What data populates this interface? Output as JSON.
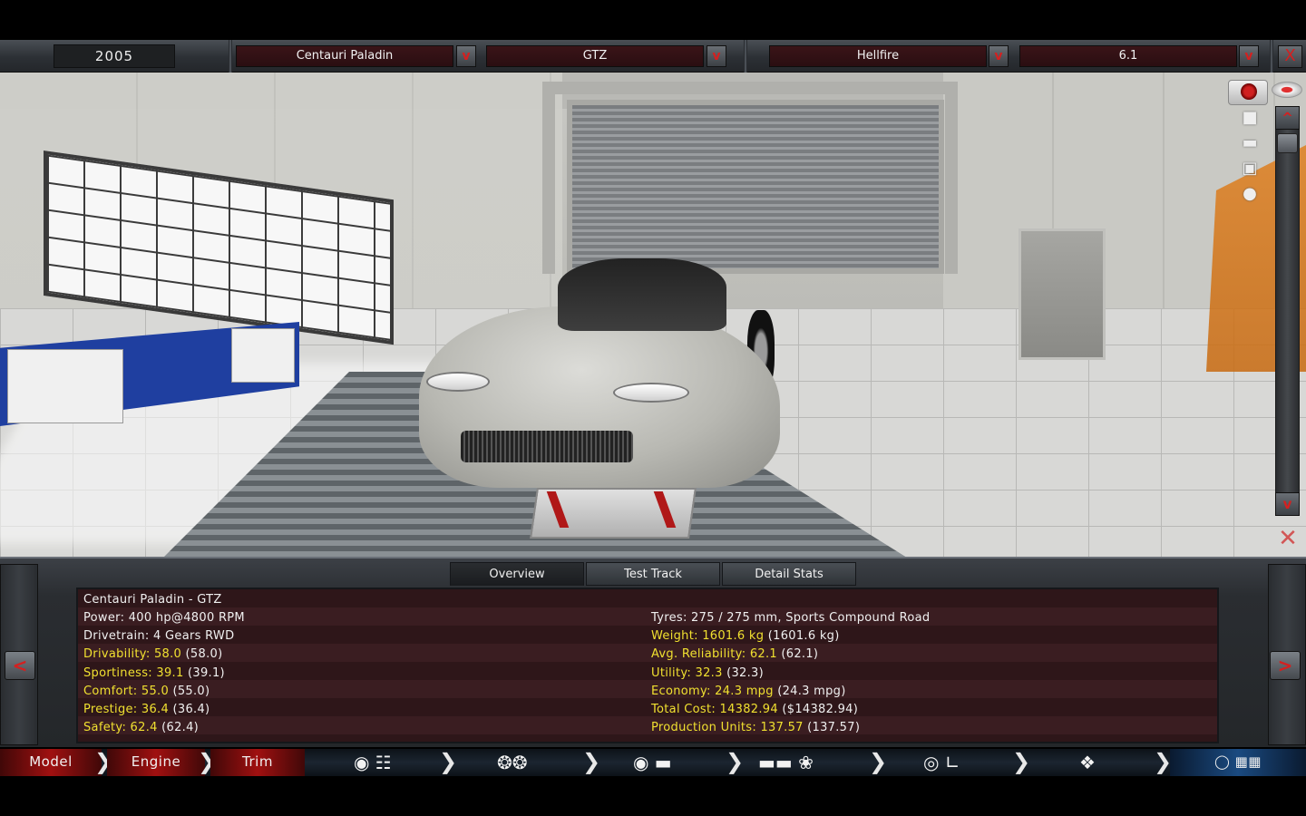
{
  "header": {
    "year": "2005",
    "make": "Centauri Paladin",
    "model": "GTZ",
    "engine": "Hellfire",
    "displacement": "6.1",
    "dropdown_glyph": "v",
    "close_glyph": "X"
  },
  "scene": {
    "scroll_up": "^",
    "scroll_down": "v"
  },
  "tabs": [
    "Overview",
    "Test Track",
    "Detail Stats"
  ],
  "panel": {
    "prev": "<",
    "next": ">",
    "title": "Centauri Paladin - GTZ",
    "left": [
      {
        "key": "Power: 400 hp@4800 RPM",
        "val": "",
        "highlight": false
      },
      {
        "key": "Drivetrain: 4 Gears RWD",
        "val": "",
        "highlight": false
      },
      {
        "key": "Drivability: 58.0",
        "val": " (58.0)",
        "highlight": true
      },
      {
        "key": "Sportiness: 39.1",
        "val": " (39.1)",
        "highlight": true
      },
      {
        "key": "Comfort: 55.0",
        "val": " (55.0)",
        "highlight": true
      },
      {
        "key": "Prestige: 36.4",
        "val": " (36.4)",
        "highlight": true
      },
      {
        "key": "Safety: 62.4",
        "val": " (62.4)",
        "highlight": true
      }
    ],
    "right": [
      {
        "key": "Tyres: 275 / 275 mm, Sports Compound Road",
        "val": "",
        "highlight": false
      },
      {
        "key": "Weight: 1601.6 kg",
        "val": " (1601.6 kg)",
        "highlight": true
      },
      {
        "key": "Avg. Reliability: 62.1",
        "val": " (62.1)",
        "highlight": true
      },
      {
        "key": "Utility: 32.3",
        "val": " (32.3)",
        "highlight": true
      },
      {
        "key": "Economy: 24.3 mpg",
        "val": " (24.3 mpg)",
        "highlight": true
      },
      {
        "key": "Total Cost: 14382.94",
        "val": " ($14382.94)",
        "highlight": true
      },
      {
        "key": "Production Units: 137.57",
        "val": " (137.57)",
        "highlight": true
      }
    ]
  },
  "nav": {
    "model": "Model",
    "engine": "Engine",
    "trim": "Trim",
    "icons": [
      "wheel-gears-icon",
      "tyres-icon",
      "brakes-icon",
      "aero-icon",
      "interior-icon",
      "suspension-icon",
      "finish-icon"
    ]
  }
}
